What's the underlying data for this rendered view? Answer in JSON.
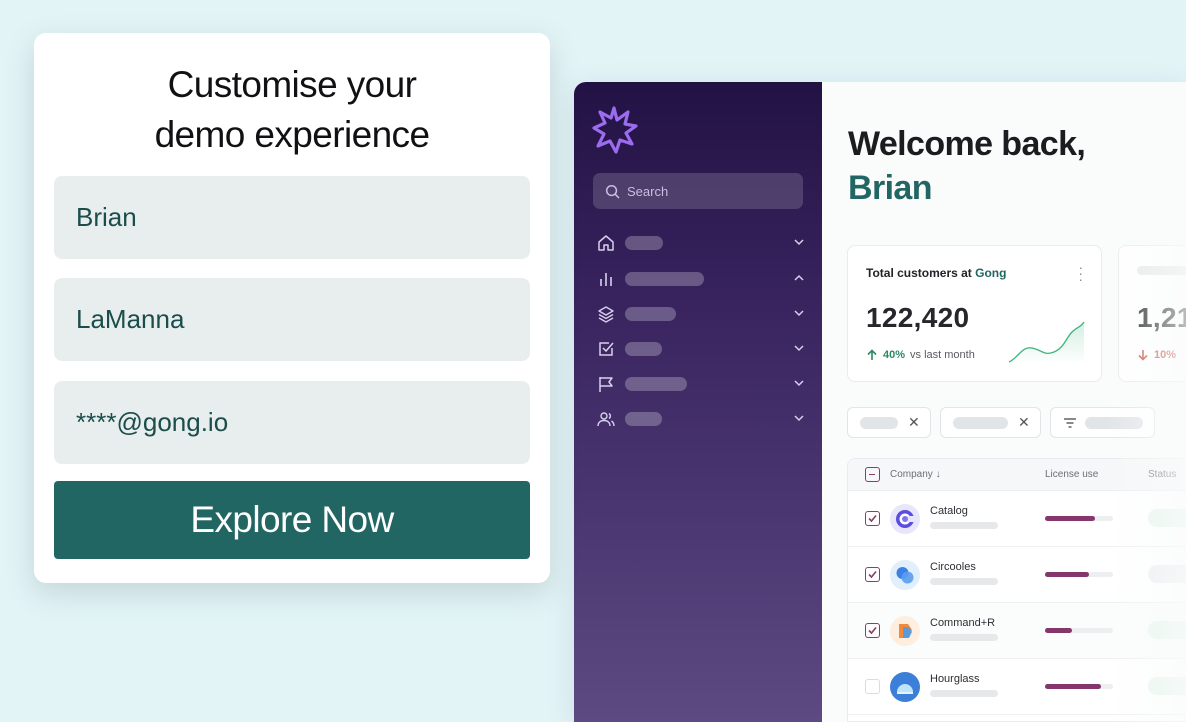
{
  "form": {
    "title_line1": "Customise your",
    "title_line2": "demo experience",
    "first_name": "Brian",
    "last_name": "LaManna",
    "email": "****@gong.io",
    "cta_label": "Explore Now"
  },
  "sidebar": {
    "search_placeholder": "Search",
    "items": [
      {
        "icon": "home-icon",
        "chevron": "down"
      },
      {
        "icon": "bar-chart-icon",
        "chevron": "up"
      },
      {
        "icon": "layers-icon",
        "chevron": "down"
      },
      {
        "icon": "checkbox-icon",
        "chevron": "down"
      },
      {
        "icon": "flag-icon",
        "chevron": "down"
      },
      {
        "icon": "users-icon",
        "chevron": "down"
      }
    ]
  },
  "main": {
    "welcome_line": "Welcome back,",
    "user_name": "Brian",
    "card1": {
      "title_prefix": "Total customers at ",
      "title_brand": "Gong",
      "value": "122,420",
      "delta": "40%",
      "delta_direction": "up",
      "delta_caption": "vs last month"
    },
    "card2": {
      "value": "1,21",
      "delta": "10%",
      "delta_direction": "down"
    },
    "table": {
      "headers": {
        "company": "Company",
        "license": "License use",
        "status": "Status"
      },
      "rows": [
        {
          "name": "Catalog",
          "checked": true,
          "license_fraction": 0.73,
          "status_color": "#e8f6ee"
        },
        {
          "name": "Circooles",
          "checked": true,
          "license_fraction": 0.65,
          "status_color": "#eceef0"
        },
        {
          "name": "Command+R",
          "checked": true,
          "license_fraction": 0.4,
          "status_color": "#e8f6ee"
        },
        {
          "name": "Hourglass",
          "checked": false,
          "license_fraction": 0.82,
          "status_color": "#e8f6ee"
        }
      ]
    }
  },
  "colors": {
    "brand_teal": "#226664",
    "sidebar_top": "#221244",
    "sidebar_bottom": "#5d4a82",
    "accent_plum": "#85366b",
    "positive": "#2b8a63",
    "negative": "#c5523f"
  }
}
